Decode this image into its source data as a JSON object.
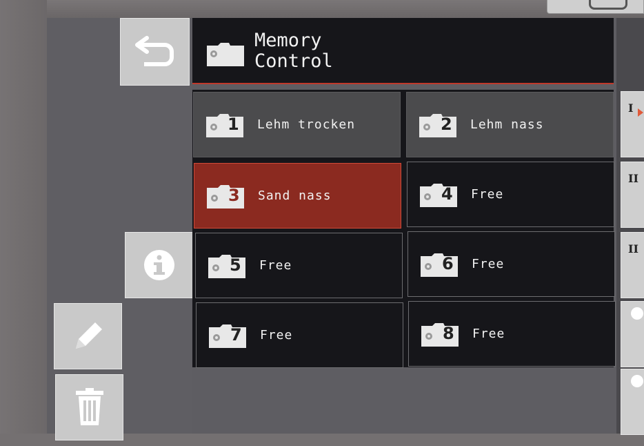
{
  "header": {
    "title": "Memory\nControl",
    "icon": "folder-gear-icon"
  },
  "toolbar": {
    "back_icon": "back-arrow-icon",
    "info_icon": "info-icon",
    "edit_icon": "pencil-icon",
    "delete_icon": "trash-icon"
  },
  "slots": [
    {
      "number": "1",
      "label": "Lehm trocken",
      "state": "filled"
    },
    {
      "number": "2",
      "label": "Lehm nass",
      "state": "filled"
    },
    {
      "number": "3",
      "label": "Sand nass",
      "state": "selected"
    },
    {
      "number": "4",
      "label": "Free",
      "state": "empty"
    },
    {
      "number": "5",
      "label": "Free",
      "state": "empty"
    },
    {
      "number": "6",
      "label": "Free",
      "state": "empty"
    },
    {
      "number": "7",
      "label": "Free",
      "state": "empty"
    },
    {
      "number": "8",
      "label": "Free",
      "state": "empty"
    }
  ],
  "right_rail": {
    "items": [
      {
        "roman": "I",
        "active": true
      },
      {
        "roman": "II",
        "active": false
      },
      {
        "roman": "II",
        "active": false
      },
      {
        "roman": "",
        "active": false
      },
      {
        "roman": "",
        "active": false
      }
    ]
  },
  "colors": {
    "accent": "#c0392b",
    "selected_bg": "#8b2a20",
    "filled_bg": "#4b4b4d",
    "empty_bg": "#16161a"
  }
}
